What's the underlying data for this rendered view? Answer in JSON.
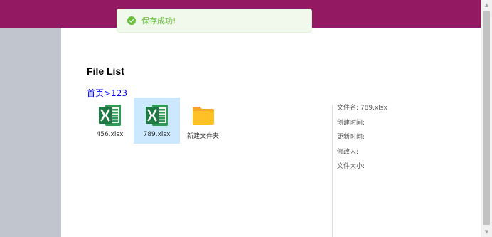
{
  "toast": {
    "icon": "success-check-icon",
    "message": "保存成功!"
  },
  "page": {
    "title": "File List"
  },
  "breadcrumb": {
    "text": "首页>123"
  },
  "files": [
    {
      "name": "456.xlsx",
      "icon": "excel-file-icon",
      "selected": false
    },
    {
      "name": "789.xlsx",
      "icon": "excel-file-icon",
      "selected": true
    },
    {
      "name": "新建文件夹",
      "icon": "folder-icon",
      "selected": false
    }
  ],
  "details": {
    "filename": "文件名: 789.xlsx",
    "created": "创建时间:",
    "updated": "更新时间:",
    "modifier": "修改人:",
    "size": "文件大小:"
  },
  "colors": {
    "topbar": "#941963",
    "sidebar": "#c1c5ce",
    "toast_bg": "#f0f9eb",
    "toast_text": "#67c23a",
    "selected_bg": "#cce8ff",
    "link": "#0000ee",
    "excel_green": "#1d7a43",
    "folder_yellow": "#ffc125"
  }
}
